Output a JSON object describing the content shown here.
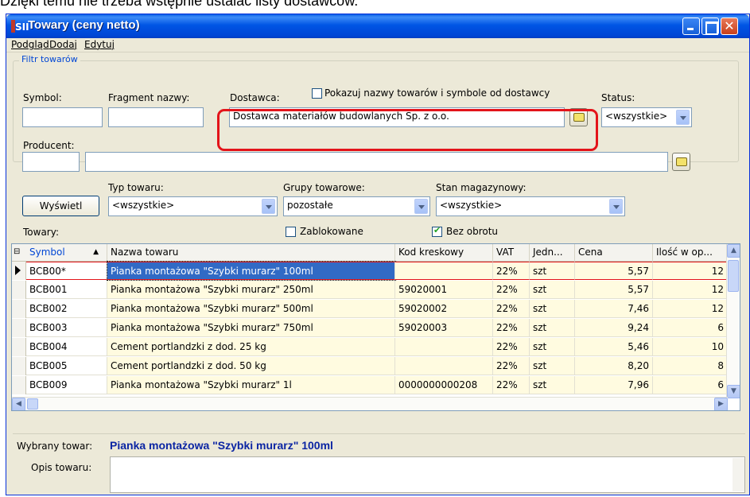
{
  "caption": "Dzięki temu nie trzeba wstępnie ustalać listy dostawców.",
  "window": {
    "title": "Towary (ceny netto)",
    "icon_text": "SII"
  },
  "menu": [
    "Podgląd",
    "Dodaj",
    "Edytuj"
  ],
  "filter": {
    "group_label": "Filtr towarów",
    "symbol_label": "Symbol:",
    "symbol_value": "",
    "name_fragment_label": "Fragment nazwy:",
    "name_fragment_value": "",
    "supplier_label": "Dostawca:",
    "supplier_value": "Dostawca materiałów budowlanych Sp. z o.o.",
    "show_supplier_names_label": "Pokazuj nazwy towarów i symbole od dostawcy",
    "show_supplier_names_checked": false,
    "status_label": "Status:",
    "status_value": "<wszystkie>",
    "producer_label": "Producent:",
    "producer_code": "",
    "producer_value": "",
    "show_button": "Wyświetl",
    "product_type_label": "Typ towaru:",
    "product_type_value": "<wszystkie>",
    "product_groups_label": "Grupy towarowe:",
    "product_groups_value": "pozostałe",
    "stock_label": "Stan magazynowy:",
    "stock_value": "<wszystkie>",
    "blocked_label": "Zablokowane",
    "blocked_checked": false,
    "no_turnover_label": "Bez obrotu",
    "no_turnover_checked": true
  },
  "products_label": "Towary:",
  "table": {
    "columns": [
      "Symbol",
      "Nazwa towaru",
      "Kod kreskowy",
      "VAT",
      "Jedn...",
      "Cena",
      "Ilość w op..."
    ],
    "rows": [
      [
        "BCB00*",
        "Pianka montażowa \"Szybki murarz\" 100ml",
        "",
        "22%",
        "szt",
        "5,57",
        "12"
      ],
      [
        "BCB001",
        "Pianka montażowa \"Szybki murarz\" 250ml",
        "59020001",
        "22%",
        "szt",
        "5,57",
        "12"
      ],
      [
        "BCB002",
        "Pianka montażowa \"Szybki murarz\" 500ml",
        "59020002",
        "22%",
        "szt",
        "7,46",
        "12"
      ],
      [
        "BCB003",
        "Pianka montażowa \"Szybki murarz\" 750ml",
        "59020003",
        "22%",
        "szt",
        "9,24",
        "6"
      ],
      [
        "BCB004",
        "Cement portlandzki z dod. 25 kg",
        "",
        "22%",
        "szt",
        "5,46",
        "10"
      ],
      [
        "BCB005",
        "Cement portlandzki z dod. 50 kg",
        "",
        "22%",
        "szt",
        "8,20",
        "8"
      ],
      [
        "BCB009",
        "Pianka montażowa \"Szybki murarz\" 1l",
        "0000000000208",
        "22%",
        "szt",
        "7,96",
        "6"
      ]
    ],
    "selected_row": 0
  },
  "selected": {
    "label": "Wybrany towar:",
    "name": "Pianka montażowa \"Szybki murarz\" 100ml",
    "description_label": "Opis towaru:",
    "description_value": ""
  },
  "colors": {
    "title_bar": "#0055e5",
    "highlight": "#e3141a",
    "selection": "#316ac5",
    "row_band": "#fffbe0"
  }
}
